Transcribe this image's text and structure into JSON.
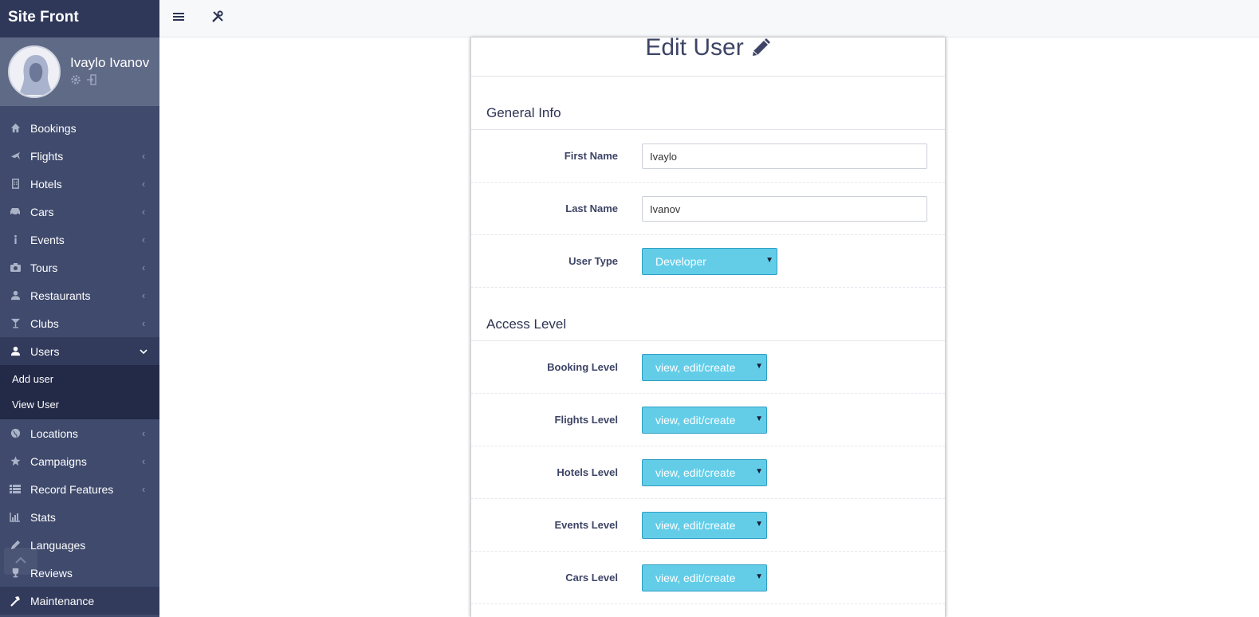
{
  "brand": "Site Front",
  "user": {
    "name": "Ivaylo Ivanov"
  },
  "nav": [
    {
      "label": "Bookings",
      "icon": "home-icon",
      "chevron": ""
    },
    {
      "label": "Flights",
      "icon": "plane-icon",
      "chevron": "‹"
    },
    {
      "label": "Hotels",
      "icon": "building-icon",
      "chevron": "‹"
    },
    {
      "label": "Cars",
      "icon": "car-icon",
      "chevron": "‹"
    },
    {
      "label": "Events",
      "icon": "info-icon",
      "chevron": "‹"
    },
    {
      "label": "Tours",
      "icon": "camera-icon",
      "chevron": "‹"
    },
    {
      "label": "Restaurants",
      "icon": "user-icon",
      "chevron": "‹"
    },
    {
      "label": "Clubs",
      "icon": "cocktail-icon",
      "chevron": "‹"
    },
    {
      "label": "Users",
      "icon": "user-icon",
      "chevron": "⌄"
    },
    {
      "label": "Locations",
      "icon": "globe-icon",
      "chevron": "‹"
    },
    {
      "label": "Campaigns",
      "icon": "star-icon",
      "chevron": "‹"
    },
    {
      "label": "Record Features",
      "icon": "list-icon",
      "chevron": "‹"
    },
    {
      "label": "Stats",
      "icon": "chart-icon",
      "chevron": ""
    },
    {
      "label": "Languages",
      "icon": "pencil-icon",
      "chevron": ""
    },
    {
      "label": "Reviews",
      "icon": "trophy-icon",
      "chevron": ""
    },
    {
      "label": "Maintenance",
      "icon": "hammer-icon",
      "chevron": ""
    }
  ],
  "users_sub": [
    "Add user",
    "View User"
  ],
  "page": {
    "title": "Edit User"
  },
  "general": {
    "heading": "General Info",
    "first_name_label": "First Name",
    "first_name_value": "Ivaylo",
    "last_name_label": "Last Name",
    "last_name_value": "Ivanov",
    "user_type_label": "User Type",
    "user_type_value": "Developer"
  },
  "access": {
    "heading": "Access Level",
    "levels": [
      {
        "label": "Booking Level",
        "value": "view, edit/create"
      },
      {
        "label": "Flights Level",
        "value": "view, edit/create"
      },
      {
        "label": "Hotels Level",
        "value": "view, edit/create"
      },
      {
        "label": "Events Level",
        "value": "view, edit/create"
      },
      {
        "label": "Cars Level",
        "value": "view, edit/create"
      }
    ]
  },
  "colors": {
    "sidebar": "#3f4a6c",
    "brand_bar": "#2f3859",
    "select": "#63cde8",
    "text_dark": "#3d4466"
  }
}
